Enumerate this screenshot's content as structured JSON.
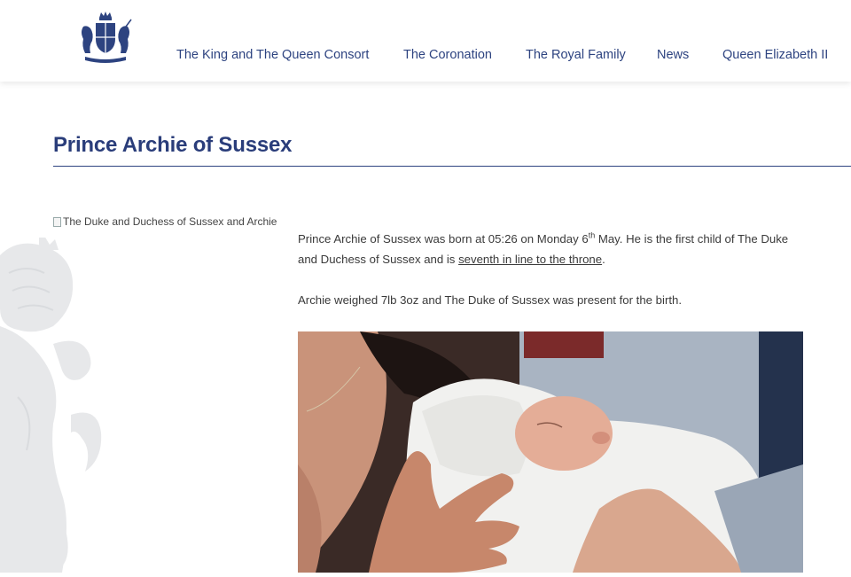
{
  "header": {
    "crest_icon": "royal-coat-of-arms-icon",
    "nav": [
      {
        "label": "The King and The Queen Consort"
      },
      {
        "label": "The Coronation"
      },
      {
        "label": "The Royal Family"
      },
      {
        "label": "News"
      },
      {
        "label": "Queen Elizabeth II"
      }
    ]
  },
  "main": {
    "title": "Prince Archie of Sussex",
    "image_alt": "The Duke and Duchess of Sussex and Archie",
    "para1": {
      "before_sup": "Prince Archie of Sussex was born at 05:26 on Monday 6",
      "sup": "th",
      "after_sup": " May. He is the first child of The Duke and Duchess of Sussex and is ",
      "link": "seventh in line to the throne",
      "end": "."
    },
    "para2": "Archie weighed 7lb 3oz and The Duke of Sussex was present for the birth."
  },
  "colors": {
    "brand_blue": "#2d4380",
    "title_blue": "#2a3d7a",
    "text": "#3a3a3a"
  }
}
